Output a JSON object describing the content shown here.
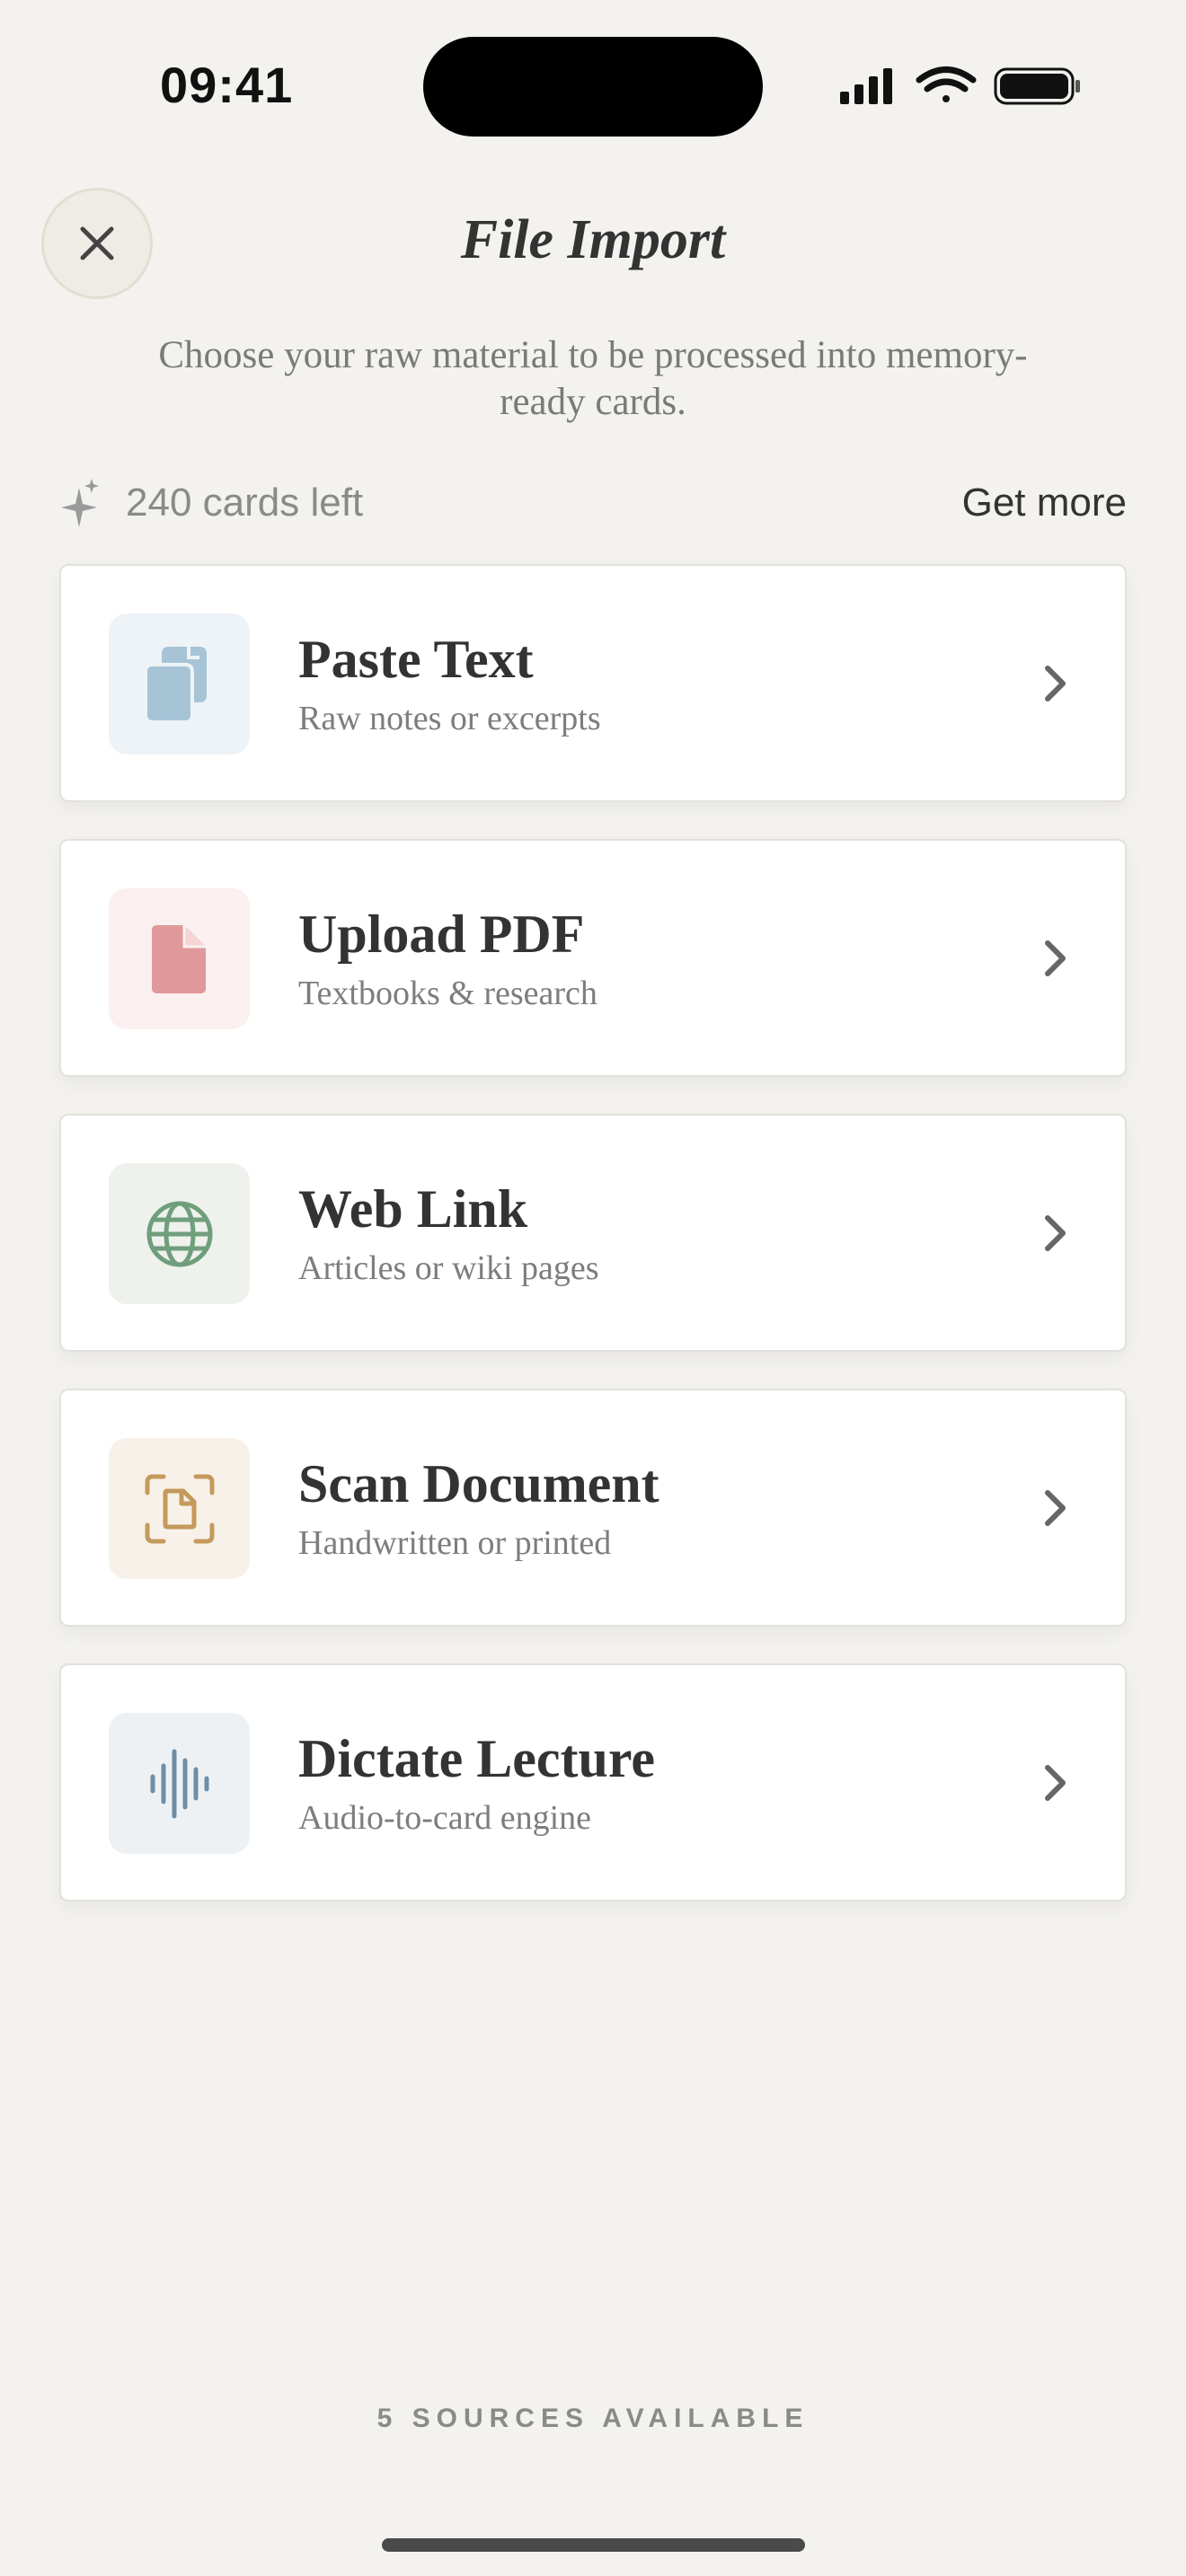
{
  "status_bar": {
    "time": "09:41"
  },
  "header": {
    "title": "File Import",
    "subtitle": "Choose your raw material to be processed into memory-ready cards."
  },
  "credits": {
    "text": "240 cards left",
    "action_label": "Get more"
  },
  "sources": [
    {
      "title": "Paste Text",
      "description": "Raw notes or excerpts",
      "icon": "paste-icon",
      "tile_color": "#eef3f7",
      "icon_color": "#a6c4d6"
    },
    {
      "title": "Upload PDF",
      "description": "Textbooks & research",
      "icon": "pdf-file-icon",
      "tile_color": "#fbf0f0",
      "icon_color": "#e0999b"
    },
    {
      "title": "Web Link",
      "description": "Articles or wiki pages",
      "icon": "globe-icon",
      "tile_color": "#eef1ec",
      "icon_color": "#6f9e7c"
    },
    {
      "title": "Scan Document",
      "description": "Handwritten or printed",
      "icon": "scan-document-icon",
      "tile_color": "#f8f1e9",
      "icon_color": "#c49a5c"
    },
    {
      "title": "Dictate Lecture",
      "description": "Audio-to-card engine",
      "icon": "waveform-icon",
      "tile_color": "#eef1f4",
      "icon_color": "#6d8ea6"
    }
  ],
  "footer": {
    "count_text": "5 SOURCES AVAILABLE"
  }
}
